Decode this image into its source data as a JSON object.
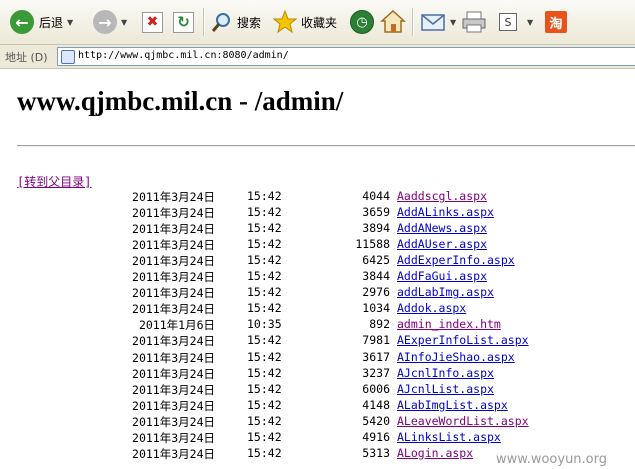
{
  "toolbar": {
    "back_label": "后退",
    "search_label": "搜索",
    "favorites_label": "收藏夹"
  },
  "address": {
    "label": "地址 (D)",
    "url": "http://www.qjmbc.mil.cn:8080/admin/"
  },
  "page": {
    "title": "www.qjmbc.mil.cn - /admin/",
    "parent_link": "[转到父目录]"
  },
  "listing": [
    {
      "date": "2011年3月24日",
      "time": "15:42",
      "size": "4044",
      "name": "Aaddscgl.aspx",
      "visited": true
    },
    {
      "date": "2011年3月24日",
      "time": "15:42",
      "size": "3659",
      "name": "AddALinks.aspx",
      "visited": false
    },
    {
      "date": "2011年3月24日",
      "time": "15:42",
      "size": "3894",
      "name": "AddANews.aspx",
      "visited": false
    },
    {
      "date": "2011年3月24日",
      "time": "15:42",
      "size": "11588",
      "name": "AddAUser.aspx",
      "visited": false
    },
    {
      "date": "2011年3月24日",
      "time": "15:42",
      "size": "6425",
      "name": "AddExperInfo.aspx",
      "visited": false
    },
    {
      "date": "2011年3月24日",
      "time": "15:42",
      "size": "3844",
      "name": "AddFaGui.aspx",
      "visited": false
    },
    {
      "date": "2011年3月24日",
      "time": "15:42",
      "size": "2976",
      "name": "addLabImg.aspx",
      "visited": false
    },
    {
      "date": "2011年3月24日",
      "time": "15:42",
      "size": "1034",
      "name": "Addok.aspx",
      "visited": false
    },
    {
      "date": "2011年1月6日",
      "time": "10:35",
      "size": "892",
      "name": "admin_index.htm",
      "visited": true
    },
    {
      "date": "2011年3月24日",
      "time": "15:42",
      "size": "7981",
      "name": "AExperInfoList.aspx",
      "visited": false
    },
    {
      "date": "2011年3月24日",
      "time": "15:42",
      "size": "3617",
      "name": "AInfoJieShao.aspx",
      "visited": false
    },
    {
      "date": "2011年3月24日",
      "time": "15:42",
      "size": "3237",
      "name": "AJcnlInfo.aspx",
      "visited": false
    },
    {
      "date": "2011年3月24日",
      "time": "15:42",
      "size": "6006",
      "name": "AJcnlList.aspx",
      "visited": false
    },
    {
      "date": "2011年3月24日",
      "time": "15:42",
      "size": "4148",
      "name": "ALabImgList.aspx",
      "visited": false
    },
    {
      "date": "2011年3月24日",
      "time": "15:42",
      "size": "5420",
      "name": "ALeaveWordList.aspx",
      "visited": true
    },
    {
      "date": "2011年3月24日",
      "time": "15:42",
      "size": "4916",
      "name": "ALinksList.aspx",
      "visited": false
    },
    {
      "date": "2011年3月24日",
      "time": "15:42",
      "size": "5313",
      "name": "ALogin.aspx",
      "visited": true
    }
  ],
  "watermark": "www.wooyun.org",
  "colors": {
    "visited_link": "#800080",
    "link": "#0000cc"
  },
  "icons": [
    "back-icon",
    "forward-icon",
    "stop-icon",
    "refresh-icon",
    "search-icon",
    "favorites-star-icon",
    "history-icon",
    "home-icon",
    "mail-icon",
    "print-icon",
    "edit-icon",
    "app-icon"
  ]
}
